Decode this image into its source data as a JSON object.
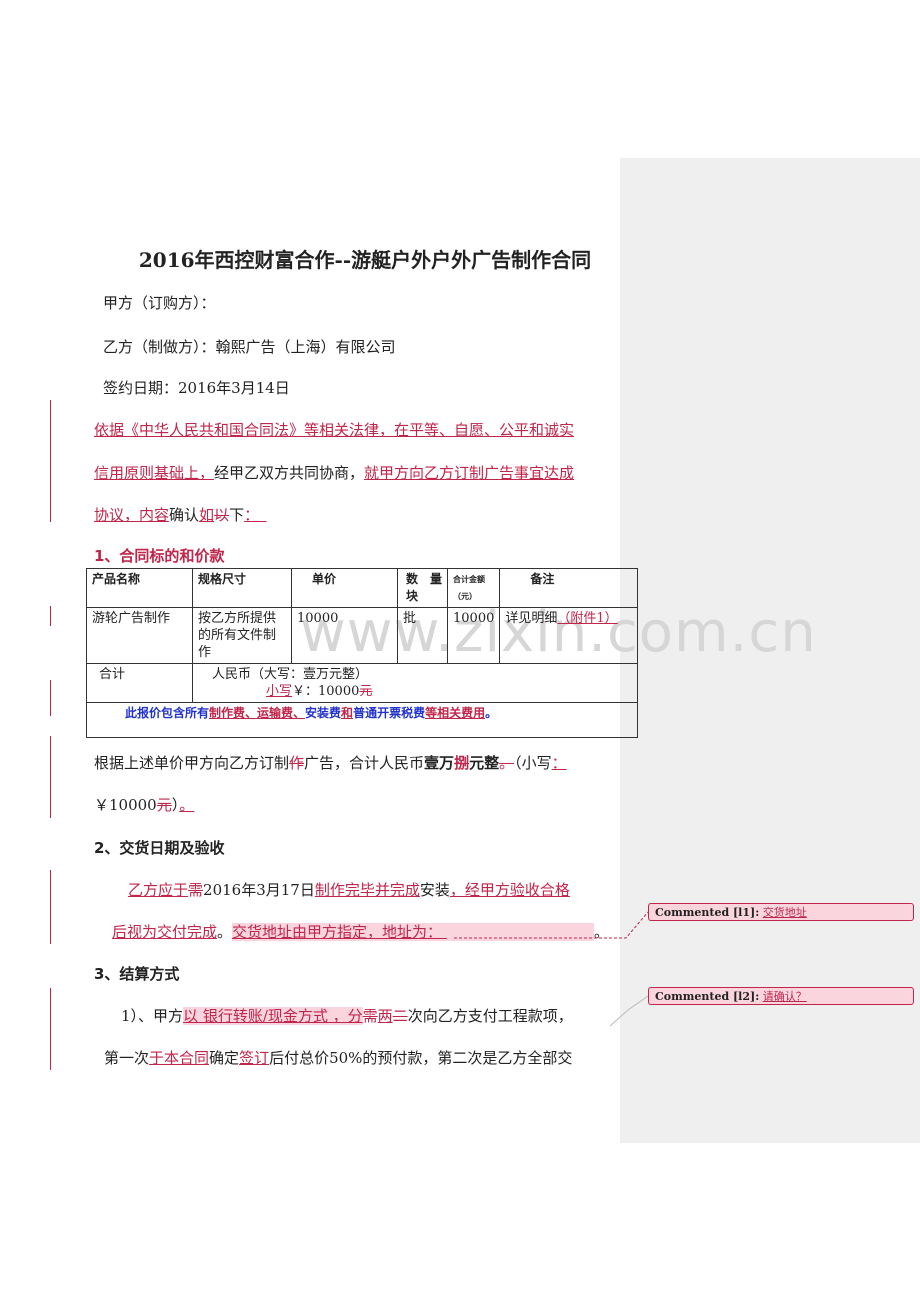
{
  "title": "2016年西控财富合作--游艇户外户外广告制作合同",
  "party_a": "甲方（订购方）：",
  "party_b": "乙方（制做方）：翰熙广告（上海）有限公司",
  "sign_date": "签约日期：2016年3月14日",
  "intro": {
    "l1_ins": "依据《中华人民共和国合同法》等相关法律，在平等、自愿、公平和诚实",
    "l2_ins": "信用原则基础上，",
    "l2_plain": "经甲乙双方共同协商，",
    "l2_ins2": "就甲方向乙方订制广告事宜达成",
    "l3_ins": "协议，内容",
    "l3_plain": "确认",
    "l3_ins2": "如",
    "l3_del": "以",
    "l3_plain2": "下",
    "l3_ins3": "："
  },
  "section1": "1、合同标的和价款",
  "table": {
    "headers": [
      "产品名称",
      "规格尺寸",
      "单价",
      "数　量块",
      "合计金额（元）",
      "备注"
    ],
    "row": {
      "name": "游轮广告制作",
      "spec": "按乙方所提供的所有文件制作",
      "price": "10000",
      "qty": "批",
      "total": "10000",
      "remark_plain": "详见明细",
      "remark_ins": "（附件1）"
    },
    "sum_label": "合计",
    "sum_line1": "人民币（大写：壹万元整）",
    "sum_ins": "小写",
    "sum_plain": "￥：10000",
    "sum_del": "元",
    "note_plain1": "此报价包含所有",
    "note_ins1": "制作费、运输费、",
    "note_plain2": "安装费",
    "note_ins2": "和",
    "note_plain3": "普通开票税费",
    "note_ins3": "等相关费用",
    "note_end": "。"
  },
  "summary": {
    "a": "根据上述单价甲方向乙方订制",
    "a_del": "作",
    "b": "广告，合计人民币",
    "c_bold": "壹万",
    "c_del": "捌",
    "d_bold": "元整",
    "e_del": "。",
    "f": "（小写",
    "f_ins": "：",
    "g": "￥10000",
    "g_del": "元",
    "h": "）",
    "h_ins": "。"
  },
  "section2": "2、交货日期及验收",
  "delivery": {
    "a_ins": "乙方应于",
    "a_del": "需",
    "b": "2016年3月17日",
    "b_ins": "制作完毕并完成",
    "c": "安装",
    "c_ins": "，经甲方验收合格",
    "d_ins": "后视为交付完成",
    "d_plain": "。",
    "d_ins2": "交货地址由甲方指定，地址为：",
    "d_end": "。"
  },
  "section3": "3、结算方式",
  "payment": {
    "a": "1）、甲方",
    "a_ins": "以 银行转账/现金方式 ，分",
    "a_del": "需",
    "a_ins2": "两",
    "a_del2": "二",
    "b": "次向乙方支付工程款项，",
    "c": "第一次",
    "c_ins": "于本合同",
    "c_plain": "确定",
    "c_ins2": "签订",
    "c_plain2": "后付总价50%的预付款，第二次是乙方全部交"
  },
  "comments": [
    {
      "label": "Commented [l1]:",
      "text": "交货地址"
    },
    {
      "label": "Commented [l2]:",
      "text": "请确认？"
    }
  ],
  "watermark": "www.zixin.com.cn",
  "colors": {
    "revision": "#c0254a",
    "note_blue": "#2233cc",
    "pane": "#efefef"
  }
}
